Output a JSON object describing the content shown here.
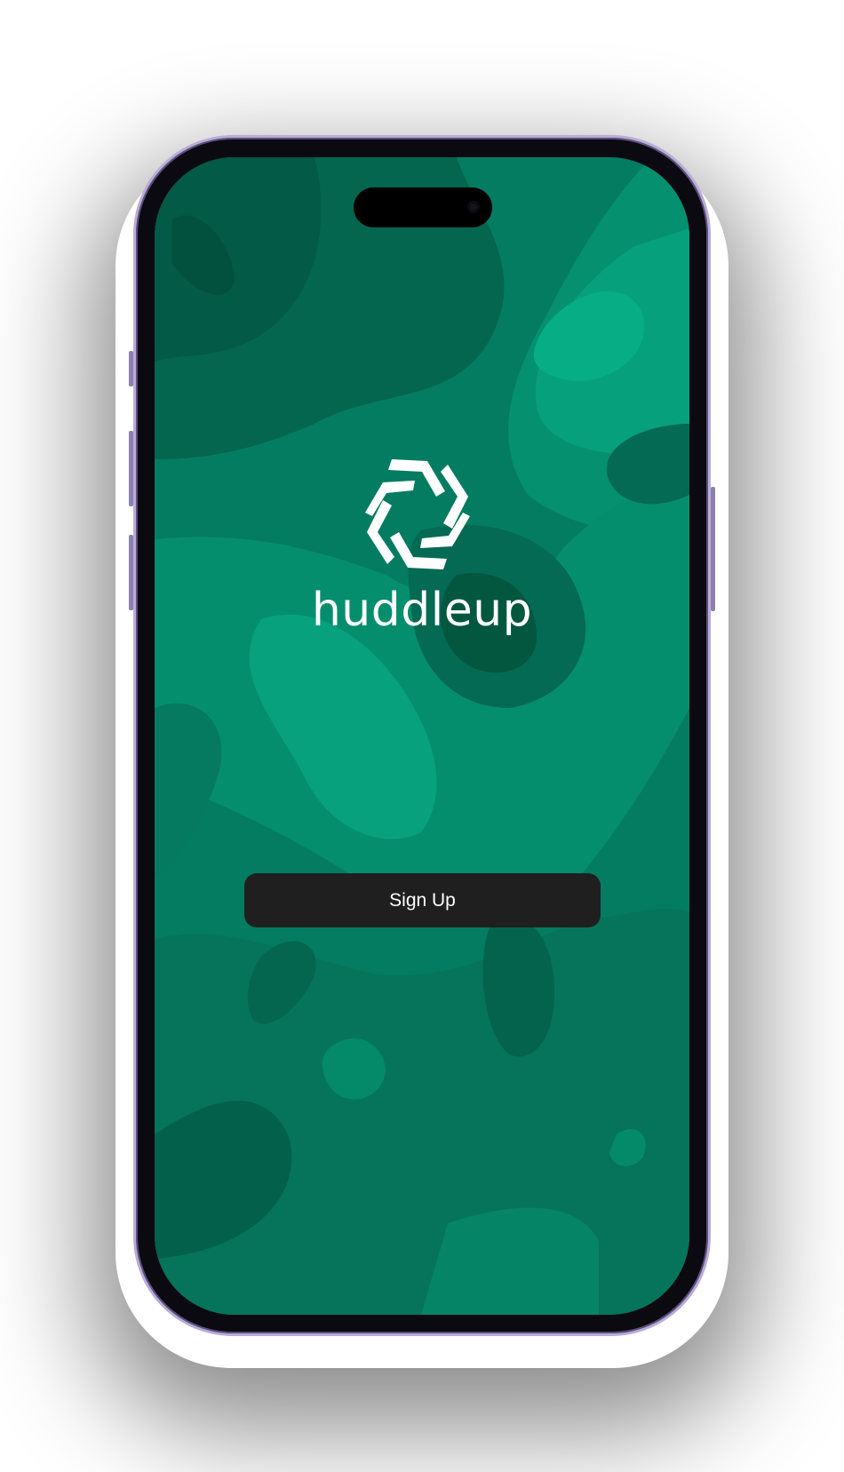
{
  "app": {
    "brand_name": "huddleup",
    "logo_icon": "hexagon-arrows-logo"
  },
  "actions": {
    "signup_label": "Sign Up"
  },
  "colors": {
    "background": "#057a60",
    "button": "#1f1f1f",
    "text": "#ffffff"
  }
}
